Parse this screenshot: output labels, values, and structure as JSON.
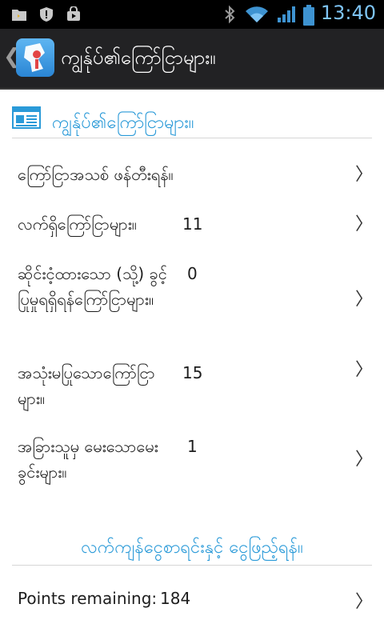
{
  "status_bar": {
    "time": "13:40",
    "left_icons": [
      "folder-icon",
      "shield-alert-icon",
      "shopping-bag-icon"
    ],
    "right_icons": [
      "bluetooth-icon",
      "wifi-icon",
      "signal-icon",
      "battery-icon"
    ]
  },
  "action_bar": {
    "title": "ကျွန်ုပ်၏ကြော်ငြာများ။",
    "up_glyph": "❮"
  },
  "section": {
    "title": "ကျွန်ုပ်၏ကြော်ငြာများ။"
  },
  "rows": [
    {
      "label": "ကြော်ငြာအသစ် ဖန်တီးရန်။",
      "value": ""
    },
    {
      "label": "လက်ရှိကြော်ငြာများ။",
      "value": "11"
    },
    {
      "label": "ဆိုင်းငံ့ထားသော (သို့) ခွင့်ပြုမှုရရှိရန်ကြော်ငြာများ။",
      "value": "0"
    },
    {
      "label": "အသုံးမပြုသောကြော်ငြာများ။",
      "value": "15"
    },
    {
      "label": "အခြားသူမှ မေးသောမေးခွင်းများ။",
      "value": "1"
    }
  ],
  "chevron": "〉",
  "section2": {
    "title": "လက်ကျန်ငွေစာရင်းနှင့် ငွေဖြည့်ရန်။"
  },
  "points": {
    "label": "Points remaining:",
    "value": "184"
  },
  "colors": {
    "accent": "#2a9ad8",
    "status_bar": "#000000",
    "action_bar": "#222224",
    "time": "#7ec4f4"
  }
}
